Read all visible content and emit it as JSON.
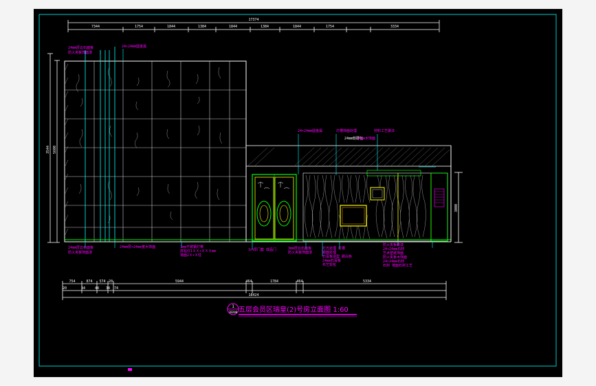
{
  "drawing": {
    "title": "五层会员区瑞皇(2)号房立面图  1:60",
    "title_marker": "1",
    "title_marker_sub": "IB200",
    "top_dims": [
      "17374",
      "7344",
      "1754",
      "1844",
      "1384",
      "1844",
      "1384",
      "1844",
      "1754",
      "3334"
    ],
    "bottom_dims_row1": [
      "754",
      "874",
      "574",
      "20",
      "5944",
      "464",
      "1784",
      "464",
      "5334"
    ],
    "bottom_dims_row2": [
      "20",
      "34",
      "44",
      "34",
      "74"
    ],
    "bottom_total": "18424",
    "left_dims": [
      "3544",
      "5600"
    ],
    "right_dims": [
      "3000"
    ],
    "annotations_top": [
      "24mm厚云石面板",
      "防火夹板饰面漆",
      "24×24mm圆金属",
      "24×24mm圆金属",
      "灯槽饰面处理",
      "24mm软硬包",
      "材料工艺做法",
      "14mm木饰面"
    ],
    "annotations_bottom": [
      "24mm厚云石面板",
      "防火夹板饰面漆",
      "24mm厚×24mm宽木饰面",
      "1mm不锈钢灯带",
      "拼贴灯1ＸＸ×ＸＸＸmm",
      "墙面2Ｘ×Ｘ柱",
      "1ｍ厚门套 成品门",
      "3mm厚云石面板",
      "防火夹板饰面漆",
      "灯光处理 灯槽",
      "镜面处理",
      "石膏板造型 刷白色",
      "24mm石膏板",
      "布艺软包",
      "防火夹板刷漆",
      "24×24mm石材",
      "艺术壁纸饰面",
      "防火夹板木饰面",
      "24×24mm石材",
      "石材 墙面石材工艺"
    ]
  },
  "colors": {
    "background": "#000000",
    "frame": "#00cccc",
    "dimension": "#ffffff",
    "annotation": "#ff00ff",
    "leader": "#00ffff",
    "door": "#00ff00",
    "accent_yellow": "#ffff00",
    "stone": "#cccccc"
  }
}
